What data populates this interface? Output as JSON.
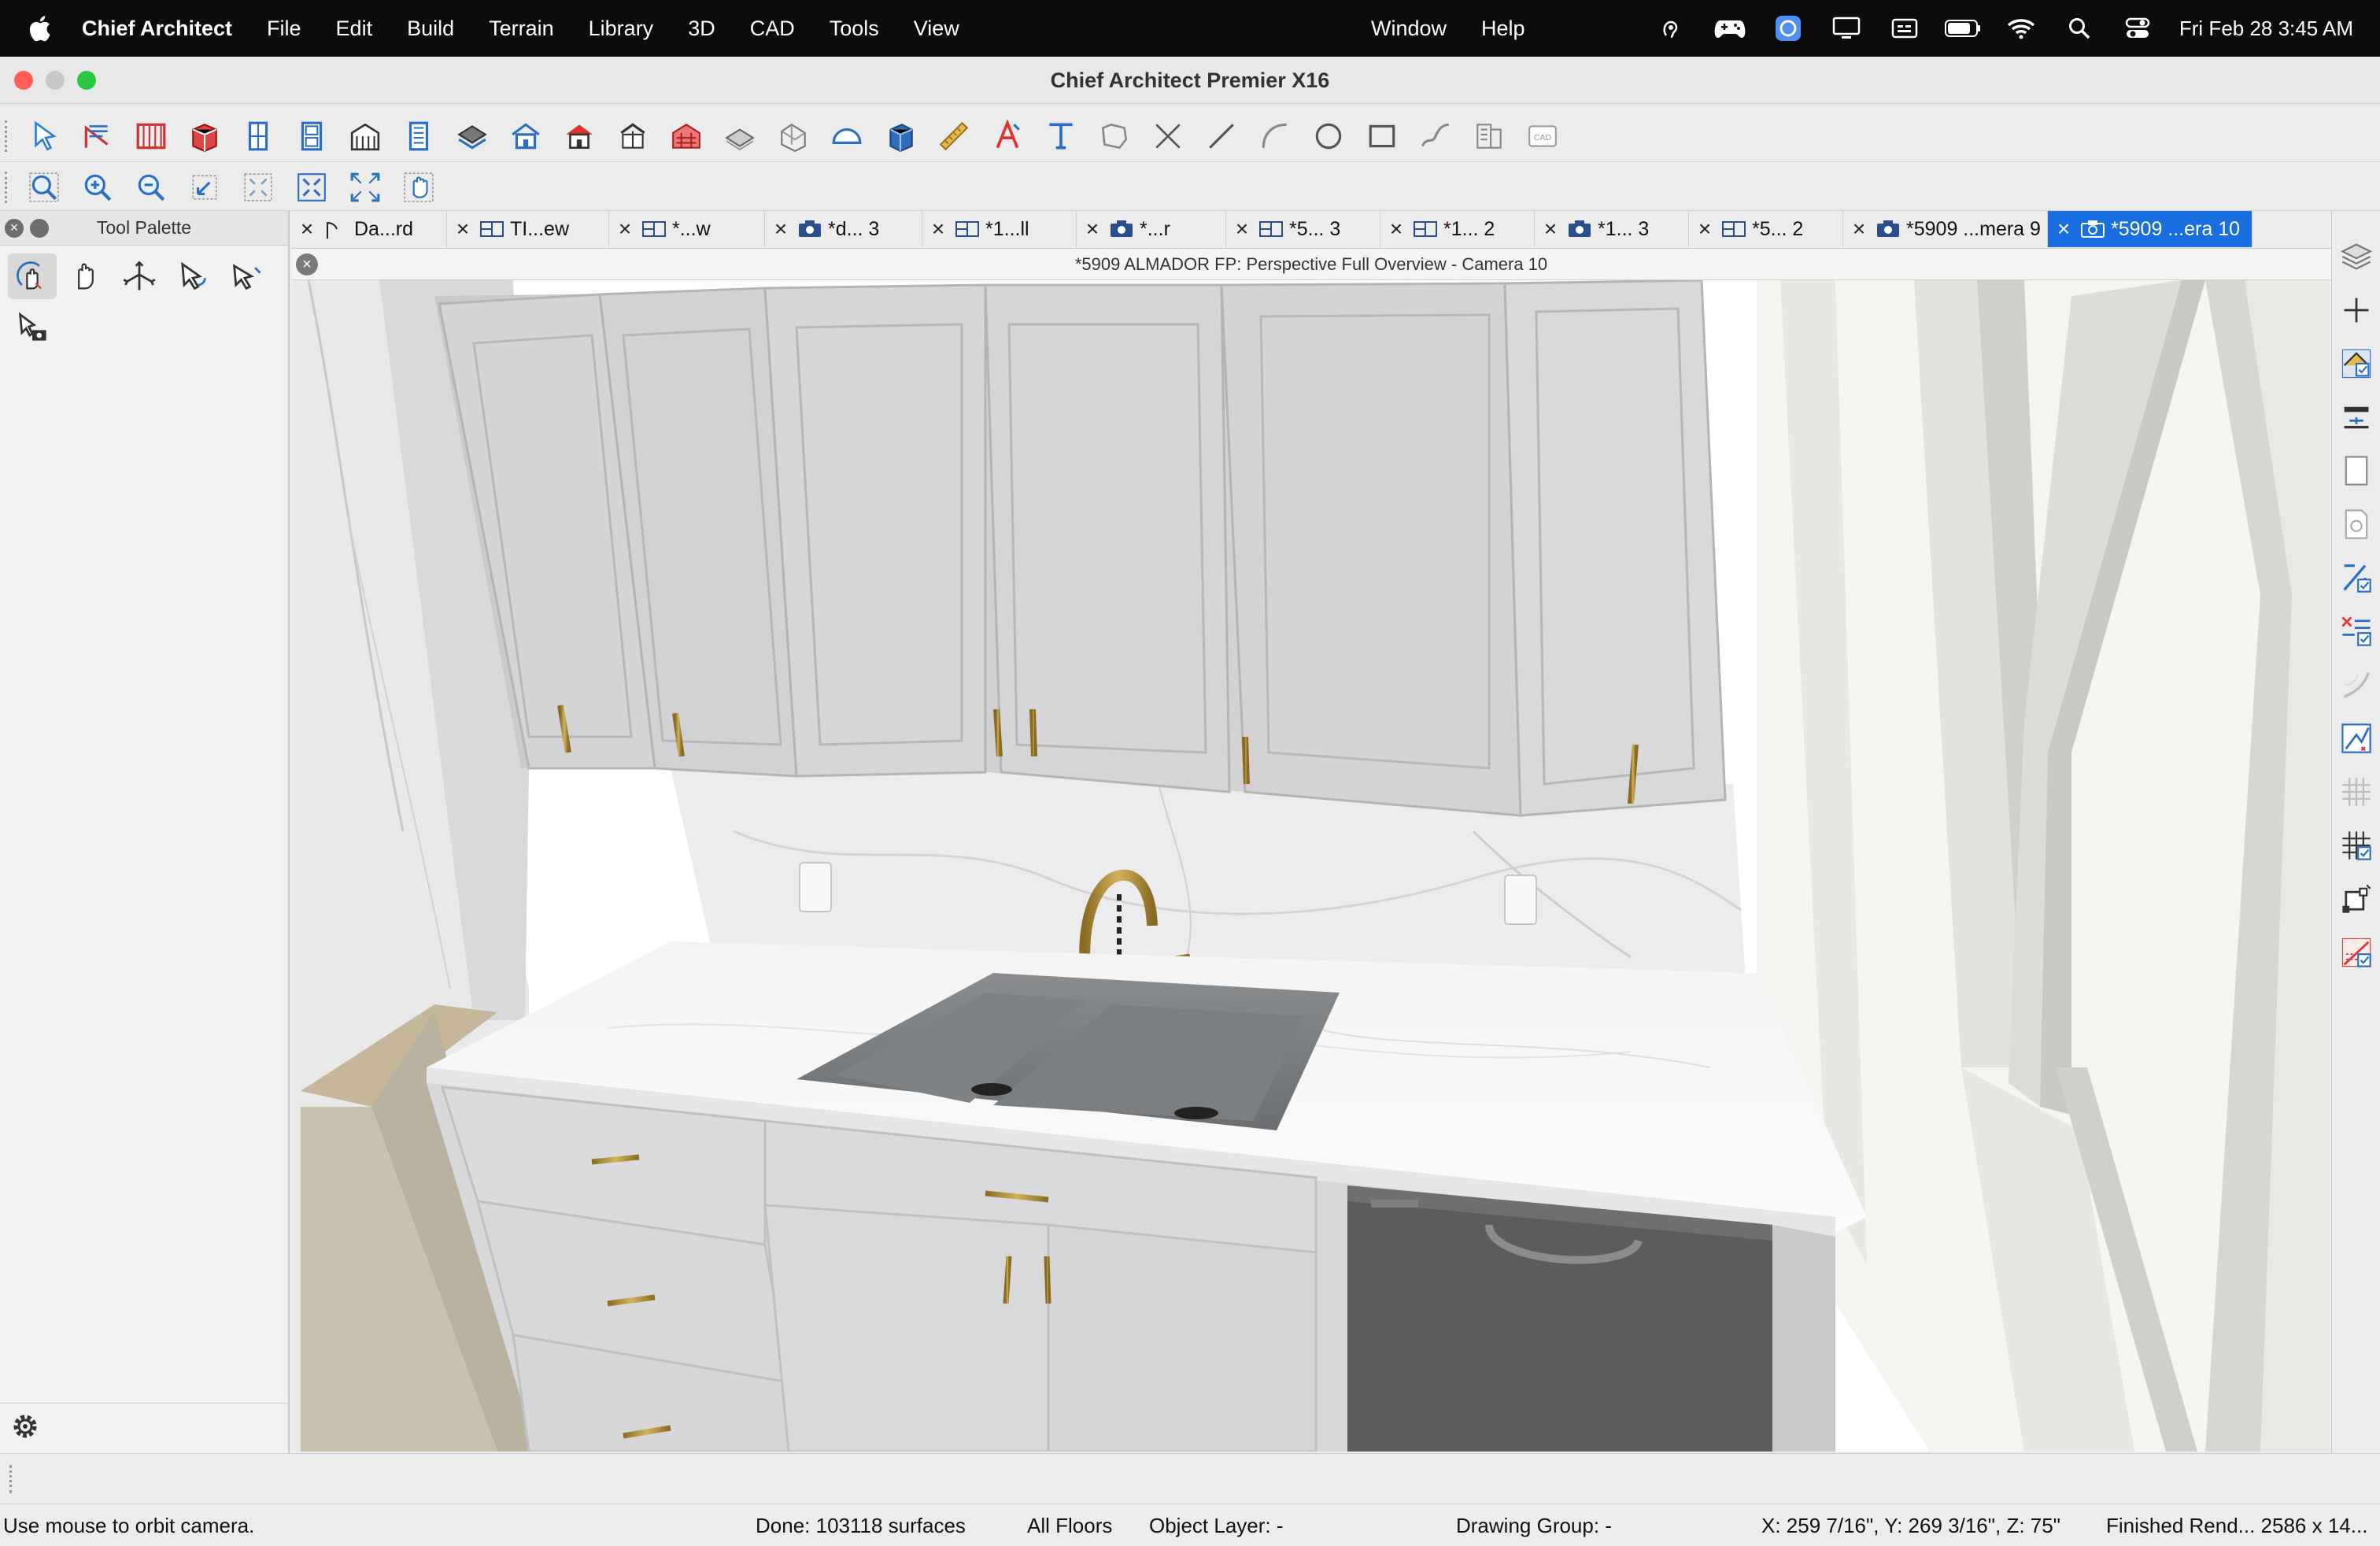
{
  "menubar": {
    "app_name": "Chief Architect",
    "menus": [
      "File",
      "Edit",
      "Build",
      "Terrain",
      "Library",
      "3D",
      "CAD",
      "Tools",
      "View"
    ],
    "right_menus": [
      "Window",
      "Help"
    ],
    "status_icons": [
      "voice-control-icon",
      "game-controller-icon",
      "app-indicator-icon",
      "display-icon",
      "keyboard-input-icon",
      "battery-icon",
      "wifi-icon",
      "spotlight-search-icon",
      "control-center-icon"
    ],
    "clock": "Fri Feb 28  3:45 AM"
  },
  "window": {
    "title": "Chief Architect Premier X16"
  },
  "toolbar1": {
    "buttons": [
      "select-objects-icon",
      "dimension-wall-icon",
      "railing-icon",
      "cabinet-icon",
      "window-tool-icon",
      "door-tool-icon",
      "framing-icon",
      "stairs-icon",
      "roof-planes-icon",
      "house-icon",
      "house-red-icon",
      "build-roof-icon",
      "shingle-roof-icon",
      "floor-icon",
      "slab-icon",
      "stairs-box-icon",
      "blue-box-icon",
      "tape-measure-icon",
      "text-style-icon",
      "text-tool-icon",
      "terrain-region-icon",
      "cross-line-icon",
      "line-tool-icon",
      "arc-tool-icon",
      "circle-tool-icon",
      "rectangle-tool-icon",
      "spline-tool-icon",
      "elevation-marker-icon",
      "cad-block-icon"
    ]
  },
  "toolbar2": {
    "buttons": [
      "zoom-window-icon",
      "zoom-in-icon",
      "zoom-out-icon",
      "undo-zoom-icon",
      "fill-window-icon",
      "fill-window-all-floors-icon",
      "fit-screen-icon",
      "pan-hand-icon"
    ]
  },
  "palette": {
    "title": "Tool Palette",
    "tools": [
      "orbit-camera-icon",
      "pan-camera-icon",
      "move-camera-icon",
      "rotate-camera-icon",
      "tilt-camera-icon",
      "walkthrough-icon"
    ]
  },
  "tabs": [
    {
      "label": "Da...rd",
      "icon": "elevation-tab-icon",
      "active": false
    },
    {
      "label": "TI...ew",
      "icon": "plan-tab-icon",
      "active": false
    },
    {
      "label": "*...w",
      "icon": "plan-tab-icon",
      "active": false
    },
    {
      "label": "*d... 3",
      "icon": "camera-tab-icon",
      "active": false
    },
    {
      "label": "*1...ll",
      "icon": "plan-tab-icon",
      "active": false
    },
    {
      "label": "*...r",
      "icon": "camera-tab-icon",
      "active": false
    },
    {
      "label": "*5... 3",
      "icon": "plan-tab-icon",
      "active": false
    },
    {
      "label": "*1... 2",
      "icon": "plan-tab-icon",
      "active": false
    },
    {
      "label": "*1... 3",
      "icon": "camera-tab-icon",
      "active": false
    },
    {
      "label": "*5... 2",
      "icon": "plan-tab-icon",
      "active": false
    },
    {
      "label": "*5909 ...mera 9",
      "icon": "camera-tab-icon",
      "active": false
    },
    {
      "label": "*5909 ...era 10",
      "icon": "camera-tab-icon",
      "active": true
    }
  ],
  "view": {
    "title": "*5909 ALMADOR FP: Perspective Full Overview - Camera 10"
  },
  "rightstrip": {
    "buttons": [
      "layers-icon",
      "plus-icon",
      "edit-material-icon",
      "wall-layer-icon",
      "page-icon",
      "preview-icon",
      "dimension-check-icon",
      "cross-section-icon",
      "curve-icon",
      "plot-icon",
      "grid-icon",
      "grid-check-icon",
      "node-icon",
      "slope-icon"
    ]
  },
  "statusbar": {
    "message": "Use mouse to orbit camera.",
    "progress": "Done:  103118 surfaces",
    "floors": "All Floors",
    "object_layer": "Object Layer: -",
    "drawing_group": "Drawing Group: -",
    "coords": "X: 259 7/16\", Y: 269 3/16\", Z: 75\"",
    "render": "Finished Rend...  2586 x 14..."
  },
  "colors": {
    "active_tab": "#1a6fe0",
    "menubar_bg": "#0c0c0c",
    "brass": "#b08d3a"
  }
}
